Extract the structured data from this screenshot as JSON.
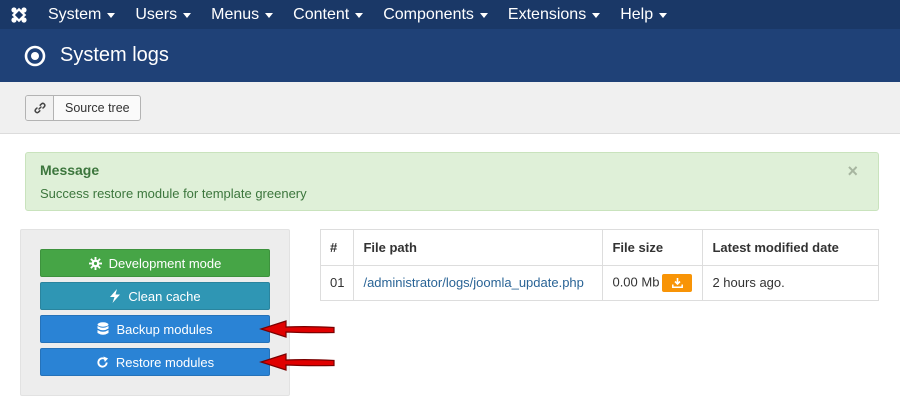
{
  "nav": {
    "items": [
      {
        "label": "System"
      },
      {
        "label": "Users"
      },
      {
        "label": "Menus"
      },
      {
        "label": "Content"
      },
      {
        "label": "Components"
      },
      {
        "label": "Extensions"
      },
      {
        "label": "Help"
      }
    ]
  },
  "header": {
    "title": "System logs"
  },
  "toolbar": {
    "source_tree_label": "Source tree"
  },
  "alert": {
    "title": "Message",
    "text": "Success restore module for template greenery",
    "close": "×"
  },
  "side": {
    "dev_mode": "Development mode",
    "clean_cache": "Clean cache",
    "backup": "Backup modules",
    "restore": "Restore modules"
  },
  "table": {
    "headers": [
      "#",
      "File path",
      "File size",
      "Latest modified date"
    ],
    "rows": [
      {
        "num": "01",
        "path": "/administrator/logs/joomla_update.php",
        "size": "0.00 Mb",
        "date": "2 hours ago."
      }
    ]
  },
  "colors": {
    "nav_bg": "#1a3867",
    "header_bg": "#1f4177",
    "success_bg": "#dff0d8",
    "btn_green": "#46a546",
    "btn_teal": "#2f96b4",
    "btn_blue": "#2a83d5",
    "btn_orange": "#f89406",
    "annotation_arrow": "#e00000"
  }
}
